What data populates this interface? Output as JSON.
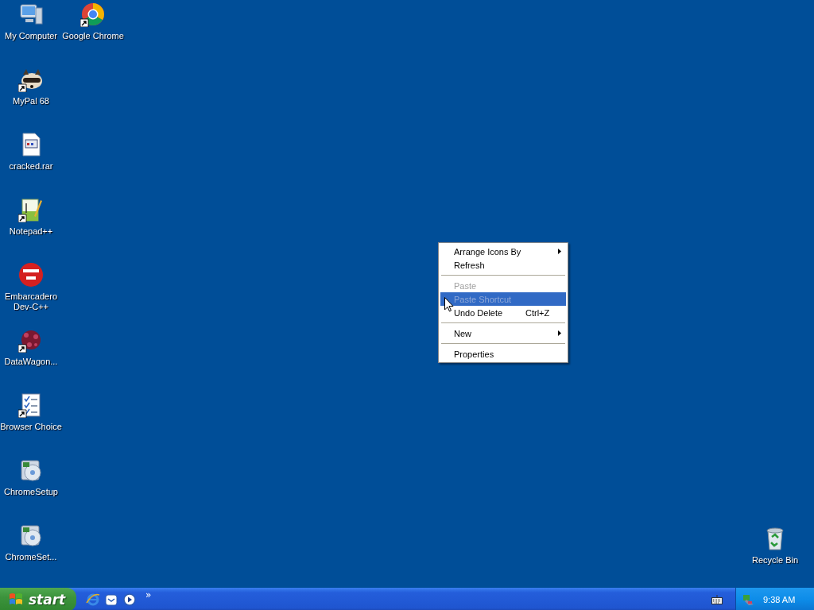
{
  "desktop": {
    "columns": [
      [
        {
          "label": "My Computer",
          "kind": "computer",
          "shortcut": false
        },
        {
          "label": "MyPal 68",
          "kind": "raccoon",
          "shortcut": true
        },
        {
          "label": "cracked.rar",
          "kind": "document",
          "shortcut": false
        },
        {
          "label": "Notepad++",
          "kind": "notepad",
          "shortcut": true
        },
        {
          "label": "Embarcadero Dev-C++",
          "kind": "dev",
          "shortcut": false
        },
        {
          "label": "DataWagon...",
          "kind": "dots",
          "shortcut": true
        },
        {
          "label": "Browser Choice",
          "kind": "checklist",
          "shortcut": true
        },
        {
          "label": "ChromeSetup",
          "kind": "setup",
          "shortcut": false
        },
        {
          "label": "ChromeSet...",
          "kind": "setup",
          "shortcut": false
        }
      ],
      [
        {
          "label": "Google Chrome",
          "kind": "chrome",
          "shortcut": true
        }
      ]
    ],
    "recycle_bin": {
      "label": "Recycle Bin",
      "kind": "recycle"
    }
  },
  "context_menu": [
    {
      "kind": "item",
      "label": "Arrange Icons By",
      "submenu": true,
      "disabled": false,
      "selected": false
    },
    {
      "kind": "item",
      "label": "Refresh",
      "submenu": false,
      "disabled": false,
      "selected": false
    },
    {
      "kind": "separator"
    },
    {
      "kind": "item",
      "label": "Paste",
      "submenu": false,
      "disabled": true,
      "selected": false
    },
    {
      "kind": "item",
      "label": "Paste Shortcut",
      "submenu": false,
      "disabled": true,
      "selected": true
    },
    {
      "kind": "item",
      "label": "Undo Delete",
      "shortcut": "Ctrl+Z",
      "submenu": false,
      "disabled": false,
      "selected": false
    },
    {
      "kind": "separator"
    },
    {
      "kind": "item",
      "label": "New",
      "submenu": true,
      "disabled": false,
      "selected": false
    },
    {
      "kind": "separator"
    },
    {
      "kind": "item",
      "label": "Properties",
      "submenu": false,
      "disabled": false,
      "selected": false
    }
  ],
  "taskbar": {
    "start_label": "start",
    "quick_launch": [
      {
        "kind": "ie"
      },
      {
        "kind": "mail"
      },
      {
        "kind": "media"
      }
    ],
    "chevron": "»",
    "tray": {
      "icons": [
        {
          "kind": "keyboard"
        }
      ],
      "clock_icons": [
        {
          "kind": "network"
        }
      ],
      "time": "9:38 AM"
    }
  }
}
